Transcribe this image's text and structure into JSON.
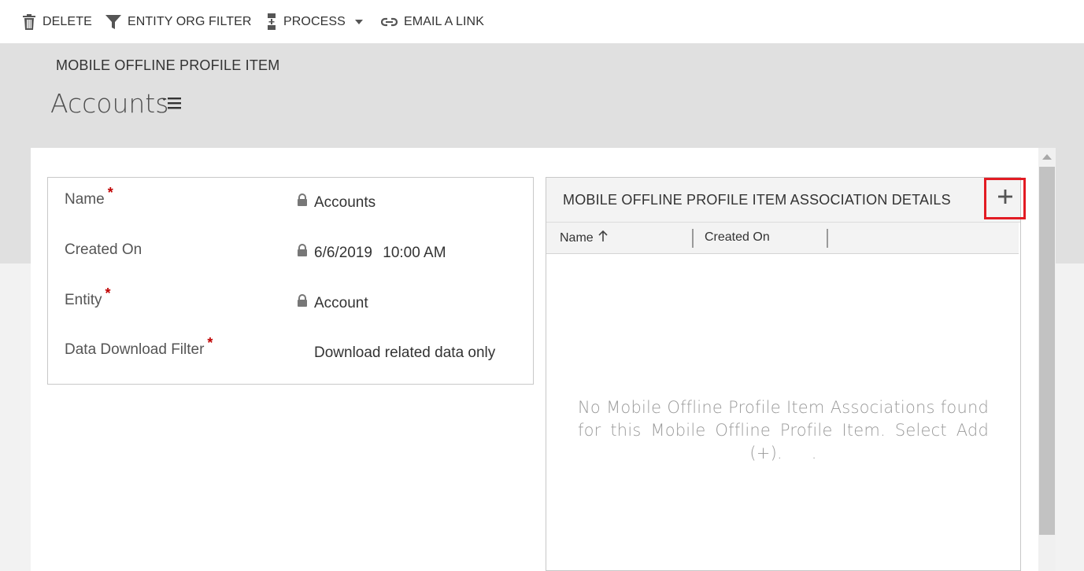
{
  "toolbar": {
    "delete_label": "DELETE",
    "entity_org_filter_label": "ENTITY ORG FILTER",
    "process_label": "PROCESS",
    "email_link_label": "EMAIL A LINK"
  },
  "header": {
    "entity_type": "MOBILE OFFLINE PROFILE ITEM",
    "record_title": "Accounts"
  },
  "fields": {
    "name": {
      "label": "Name",
      "value": "Accounts",
      "required": true,
      "locked": true
    },
    "created_on": {
      "label": "Created On",
      "date": "6/6/2019",
      "time": "10:00 AM",
      "required": false,
      "locked": true
    },
    "entity": {
      "label": "Entity",
      "value": "Account",
      "required": true,
      "locked": true
    },
    "data_download_filter": {
      "label": "Data Download Filter",
      "value": "Download related data only",
      "required": true,
      "locked": false
    }
  },
  "required_marker": "*",
  "subgrid": {
    "title": "MOBILE OFFLINE PROFILE ITEM ASSOCIATION DETAILS",
    "columns": [
      {
        "label": "Name",
        "sort": "ascending"
      },
      {
        "label": "Created On",
        "sort": "none"
      }
    ],
    "empty_message": "No Mobile Offline Profile Item Associations found for this Mobile Offline Profile Item. Select Add (+).",
    "trailing_dot": "."
  },
  "colors": {
    "highlight": "#e21b23",
    "required": "#c00000",
    "header_band": "#e0e0e0"
  },
  "icons": [
    "trash-icon",
    "filter-icon",
    "process-icon",
    "chevron-down-icon",
    "link-icon",
    "list-menu-icon",
    "lock-icon",
    "plus-icon",
    "sort-up-arrow-icon"
  ]
}
